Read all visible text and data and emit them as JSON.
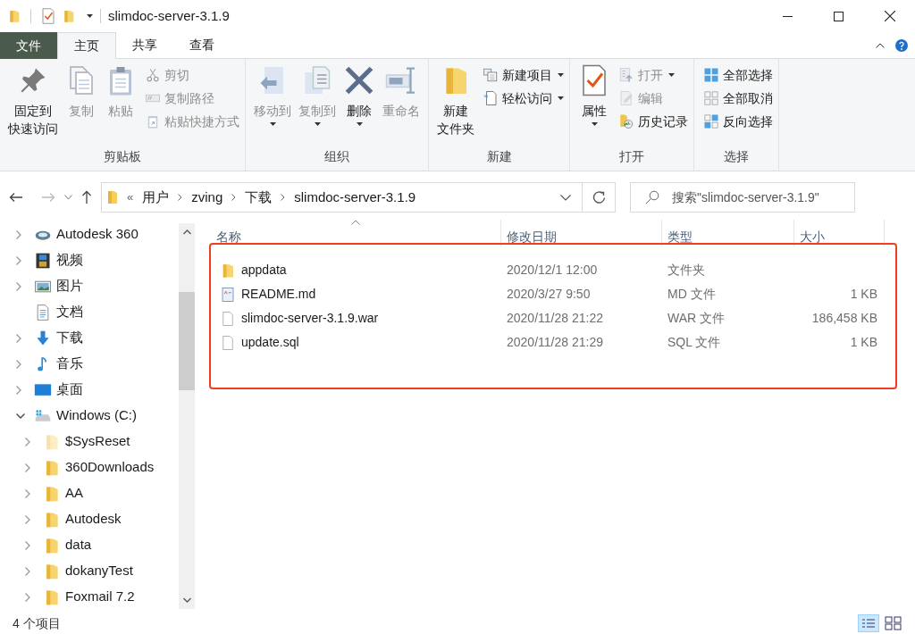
{
  "window": {
    "title": "slimdoc-server-3.1.9"
  },
  "ribbon_tabs": [
    {
      "label": "文件",
      "kind": "file",
      "selected": false
    },
    {
      "label": "主页",
      "kind": "tab",
      "selected": true
    },
    {
      "label": "共享",
      "kind": "tab",
      "selected": false
    },
    {
      "label": "查看",
      "kind": "tab",
      "selected": false
    }
  ],
  "ribbon_groups": [
    {
      "label": "剪贴板",
      "large": [
        {
          "lines": [
            "固定到",
            "快速访问"
          ],
          "kind": "pin",
          "disabled": false,
          "dropdown": false
        },
        {
          "lines": [
            "复制"
          ],
          "kind": "copy",
          "disabled": true,
          "dropdown": false
        },
        {
          "lines": [
            "粘贴"
          ],
          "kind": "paste",
          "disabled": true,
          "dropdown": false
        }
      ],
      "small": [
        {
          "label": "剪切",
          "kind": "cut",
          "disabled": true,
          "dropdown": false
        },
        {
          "label": "复制路径",
          "kind": "copy_path",
          "disabled": true,
          "dropdown": false
        },
        {
          "label": "粘贴快捷方式",
          "kind": "paste_shortcut",
          "disabled": true,
          "dropdown": false
        }
      ]
    },
    {
      "label": "组织",
      "large": [
        {
          "lines": [
            "移动到"
          ],
          "kind": "move_to",
          "disabled": true,
          "dropdown": true
        },
        {
          "lines": [
            "复制到"
          ],
          "kind": "copy_to",
          "disabled": true,
          "dropdown": true
        },
        {
          "lines": [
            "删除"
          ],
          "kind": "delete",
          "disabled": false,
          "dropdown": true
        },
        {
          "lines": [
            "重命名"
          ],
          "kind": "rename",
          "disabled": true,
          "dropdown": false
        }
      ]
    },
    {
      "label": "新建",
      "large": [
        {
          "lines": [
            "新建",
            "文件夹"
          ],
          "kind": "folder",
          "disabled": false,
          "dropdown": false
        }
      ],
      "small": [
        {
          "label": "新建项目",
          "kind": "new_item",
          "disabled": false,
          "dropdown": true
        },
        {
          "label": "轻松访问",
          "kind": "easy_access",
          "disabled": false,
          "dropdown": true
        }
      ]
    },
    {
      "label": "打开",
      "large": [
        {
          "lines": [
            "属性"
          ],
          "kind": "properties",
          "disabled": false,
          "dropdown": true
        }
      ],
      "small": [
        {
          "label": "打开",
          "kind": "open",
          "disabled": true,
          "dropdown": true
        },
        {
          "label": "编辑",
          "kind": "edit",
          "disabled": true,
          "dropdown": false
        },
        {
          "label": "历史记录",
          "kind": "history",
          "disabled": false,
          "dropdown": false
        }
      ]
    },
    {
      "label": "选择",
      "small": [
        {
          "label": "全部选择",
          "kind": "select_all",
          "disabled": false,
          "dropdown": false
        },
        {
          "label": "全部取消",
          "kind": "select_none",
          "disabled": false,
          "dropdown": false
        },
        {
          "label": "反向选择",
          "kind": "invert",
          "disabled": false,
          "dropdown": false
        }
      ]
    }
  ],
  "address_bar": {
    "overflow": "«",
    "path": [
      "用户",
      "zving",
      "下载",
      "slimdoc-server-3.1.9"
    ]
  },
  "search": {
    "placeholder": "搜索\"slimdoc-server-3.1.9\""
  },
  "sidebar": {
    "items": [
      {
        "label": "Autodesk 360",
        "kind": "cloud",
        "expandable": true,
        "expanded": false
      },
      {
        "label": "视频",
        "kind": "video",
        "expandable": true,
        "expanded": false
      },
      {
        "label": "图片",
        "kind": "pictures",
        "expandable": true,
        "expanded": false
      },
      {
        "label": "文档",
        "kind": "documents",
        "expandable": false
      },
      {
        "label": "下载",
        "kind": "downloads",
        "expandable": true,
        "expanded": false
      },
      {
        "label": "音乐",
        "kind": "music",
        "expandable": true,
        "expanded": false
      },
      {
        "label": "桌面",
        "kind": "desktop",
        "expandable": true,
        "expanded": false
      },
      {
        "label": "Windows (C:)",
        "kind": "drive",
        "expandable": true,
        "expanded": true,
        "children": [
          {
            "label": "$SysReset",
            "kind": "folder",
            "expandable": true,
            "expanded": false,
            "hidden": true
          },
          {
            "label": "360Downloads",
            "kind": "folder",
            "expandable": true,
            "expanded": false,
            "hidden": false
          },
          {
            "label": "AA",
            "kind": "folder",
            "expandable": true,
            "expanded": false,
            "hidden": false
          },
          {
            "label": "Autodesk",
            "kind": "folder",
            "expandable": true,
            "expanded": false,
            "hidden": false
          },
          {
            "label": "data",
            "kind": "folder",
            "expandable": true,
            "expanded": false,
            "hidden": false
          },
          {
            "label": "dokanyTest",
            "kind": "folder",
            "expandable": true,
            "expanded": false,
            "hidden": false
          },
          {
            "label": "Foxmail 7.2",
            "kind": "folder",
            "expandable": true,
            "expanded": false,
            "hidden": false
          }
        ]
      }
    ]
  },
  "file_list": {
    "columns": [
      "名称",
      "修改日期",
      "类型",
      "大小"
    ],
    "rows": [
      {
        "name": "appdata",
        "kind": "folder",
        "modified": "2020/12/1 12:00",
        "type": "文件夹"
      },
      {
        "name": "README.md",
        "kind": "markdown",
        "modified": "2020/3/27 9:50",
        "type": "MD 文件",
        "size": "1 KB"
      },
      {
        "name": "slimdoc-server-3.1.9.war",
        "kind": "file",
        "modified": "2020/11/28 21:22",
        "type": "WAR 文件",
        "size": "186,458 KB"
      },
      {
        "name": "update.sql",
        "kind": "file",
        "modified": "2020/11/28 21:29",
        "type": "SQL 文件",
        "size": "1 KB"
      }
    ]
  },
  "status_bar": {
    "item_count": "4 个项目"
  }
}
